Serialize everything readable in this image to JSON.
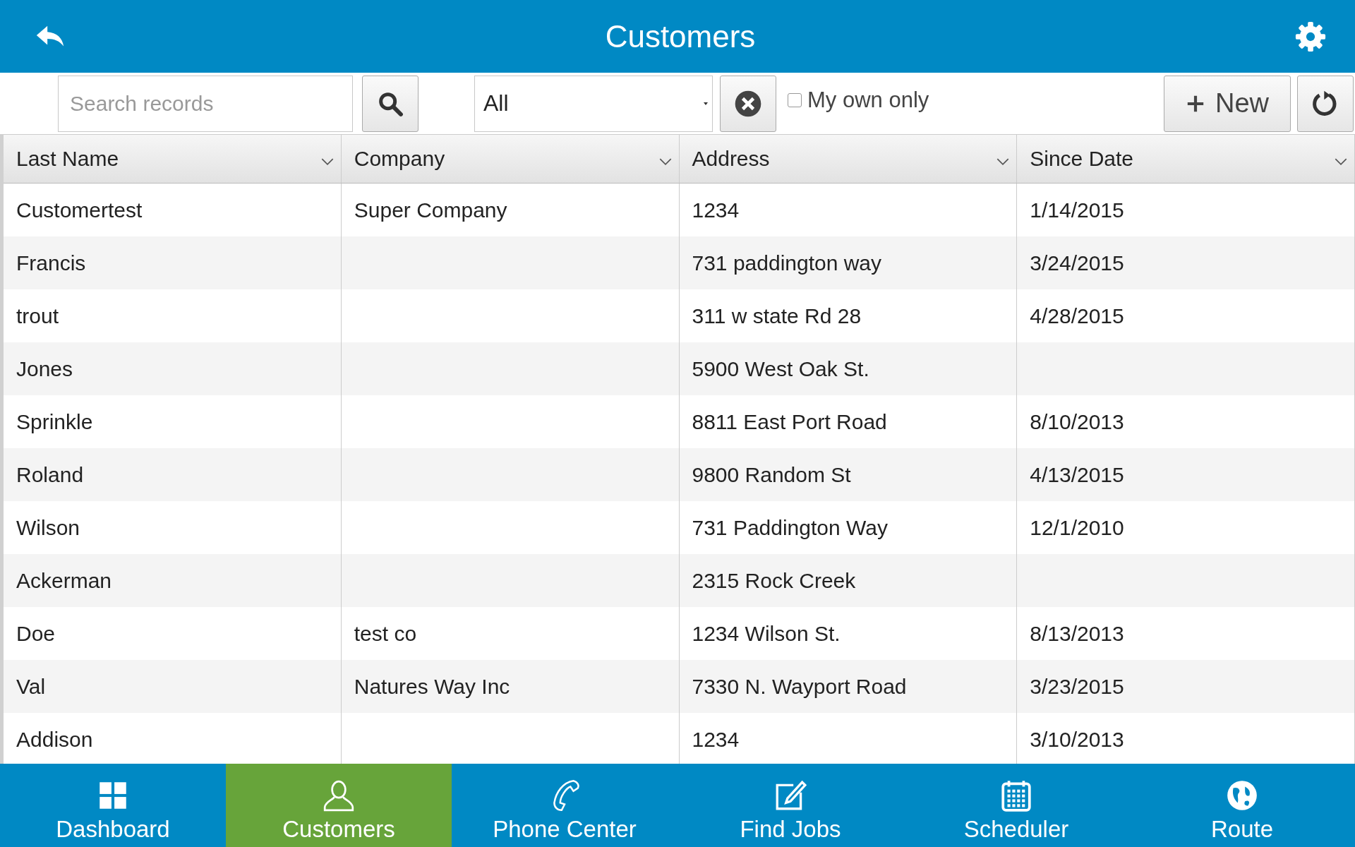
{
  "header": {
    "title": "Customers"
  },
  "toolbar": {
    "search": {
      "placeholder": "Search records"
    },
    "filter": {
      "value": "All"
    },
    "own_only": {
      "label": "My own only",
      "checked": false
    },
    "new_button": "New"
  },
  "table": {
    "columns": [
      "Last Name",
      "Company",
      "Address",
      "Since Date"
    ],
    "rows": [
      [
        "Customertest",
        "Super Company",
        "1234",
        "1/14/2015"
      ],
      [
        "Francis",
        "",
        "731 paddington way",
        "3/24/2015"
      ],
      [
        "trout",
        "",
        "311 w state Rd 28",
        "4/28/2015"
      ],
      [
        "Jones",
        "",
        "5900 West Oak St.",
        ""
      ],
      [
        "Sprinkle",
        "",
        "8811 East Port Road",
        "8/10/2013"
      ],
      [
        "Roland",
        "",
        "9800 Random St",
        "4/13/2015"
      ],
      [
        "Wilson",
        "",
        "731 Paddington Way",
        "12/1/2010"
      ],
      [
        "Ackerman",
        "",
        "2315 Rock Creek",
        ""
      ],
      [
        "Doe",
        "test co",
        "1234 Wilson St.",
        "8/13/2013"
      ],
      [
        "Val",
        "Natures Way Inc",
        "7330 N. Wayport Road",
        "3/23/2015"
      ],
      [
        "Addison",
        "",
        "1234",
        "3/10/2013"
      ]
    ]
  },
  "nav": [
    {
      "label": "Dashboard",
      "kind": "grid",
      "selected": false
    },
    {
      "label": "Customers",
      "kind": "person",
      "selected": true
    },
    {
      "label": "Phone Center",
      "kind": "phone",
      "selected": false
    },
    {
      "label": "Find Jobs",
      "kind": "edit",
      "selected": false
    },
    {
      "label": "Scheduler",
      "kind": "calendar",
      "selected": false
    },
    {
      "label": "Route",
      "kind": "globe",
      "selected": false
    }
  ]
}
